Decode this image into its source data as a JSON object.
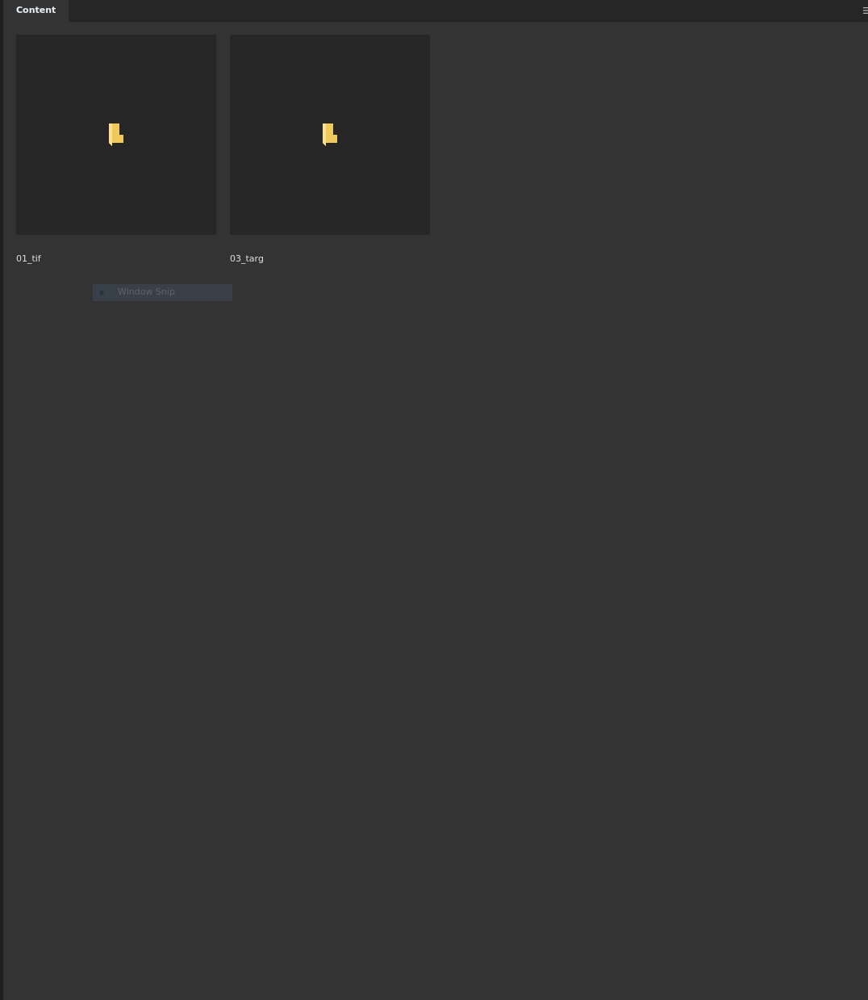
{
  "tabs": [
    {
      "label": "Content",
      "selected": true
    }
  ],
  "items": [
    {
      "name": "01_tif",
      "kind": "folder"
    },
    {
      "name": "03_targ",
      "kind": "folder"
    }
  ],
  "overlay": {
    "label": "Window Snip"
  }
}
